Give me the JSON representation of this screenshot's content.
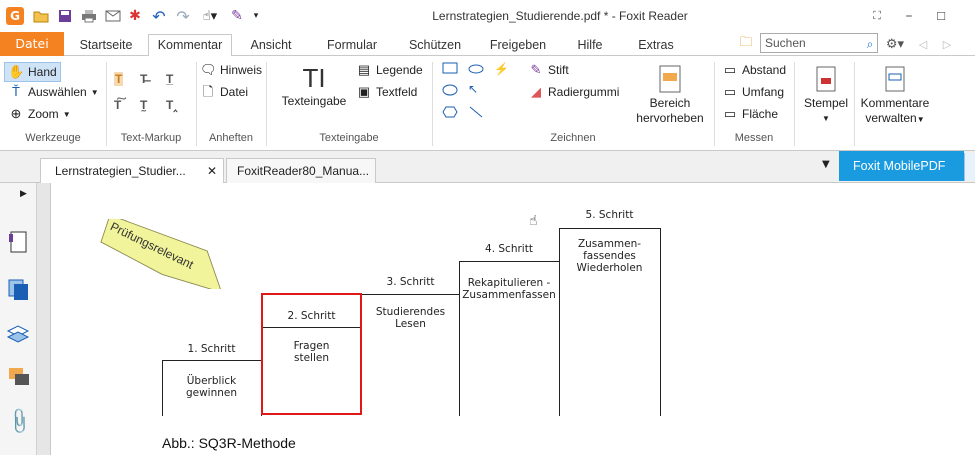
{
  "window": {
    "title": "Lernstrategien_Studierende.pdf * - Foxit Reader"
  },
  "menu": {
    "file": "Datei",
    "tabs": [
      "Startseite",
      "Kommentar",
      "Ansicht",
      "Formular",
      "Schützen",
      "Freigeben",
      "Hilfe",
      "Extras"
    ],
    "search_placeholder": "Suchen"
  },
  "ribbon": {
    "werkzeuge": {
      "hand": "Hand",
      "auswaehlen": "Auswählen",
      "zoom": "Zoom",
      "group": "Werkzeuge"
    },
    "text_markup": {
      "group": "Text-Markup"
    },
    "anheften": {
      "hinweis": "Hinweis",
      "datei": "Datei",
      "group": "Anheften"
    },
    "texteingabe": {
      "texteingabe": "Texteingabe",
      "legende": "Legende",
      "textfeld": "Textfeld",
      "group": "Texteingabe"
    },
    "zeichnen": {
      "stift": "Stift",
      "radiergummi": "Radiergummi",
      "bereich1": "Bereich",
      "bereich2": "hervorheben",
      "group": "Zeichnen"
    },
    "messen": {
      "abstand": "Abstand",
      "umfang": "Umfang",
      "flaeche": "Fläche",
      "group": "Messen"
    },
    "stempel": "Stempel",
    "kommentare1": "Kommentare",
    "kommentare2": "verwalten"
  },
  "doc_tabs": [
    "Lernstrategien_Studier...",
    "FoxitReader80_Manua..."
  ],
  "mobile_pdf": "Foxit MobilePDF",
  "document": {
    "stamp": "Prüfungsrelevant",
    "steps": [
      {
        "heading": "1. Schritt",
        "text1": "Überblick",
        "text2": "gewinnen",
        "text3": ""
      },
      {
        "heading": "2. Schritt",
        "text1": "Fragen",
        "text2": "stellen",
        "text3": ""
      },
      {
        "heading": "3. Schritt",
        "text1": "Studierendes",
        "text2": "Lesen",
        "text3": ""
      },
      {
        "heading": "4. Schritt",
        "text1": "Rekapitulieren -",
        "text2": "Zusammenfassen",
        "text3": ""
      },
      {
        "heading": "5. Schritt",
        "text1": "Zusammen-",
        "text2": "fassendes",
        "text3": "Wiederholen"
      }
    ],
    "caption": "Abb.: SQ3R-Methode"
  }
}
